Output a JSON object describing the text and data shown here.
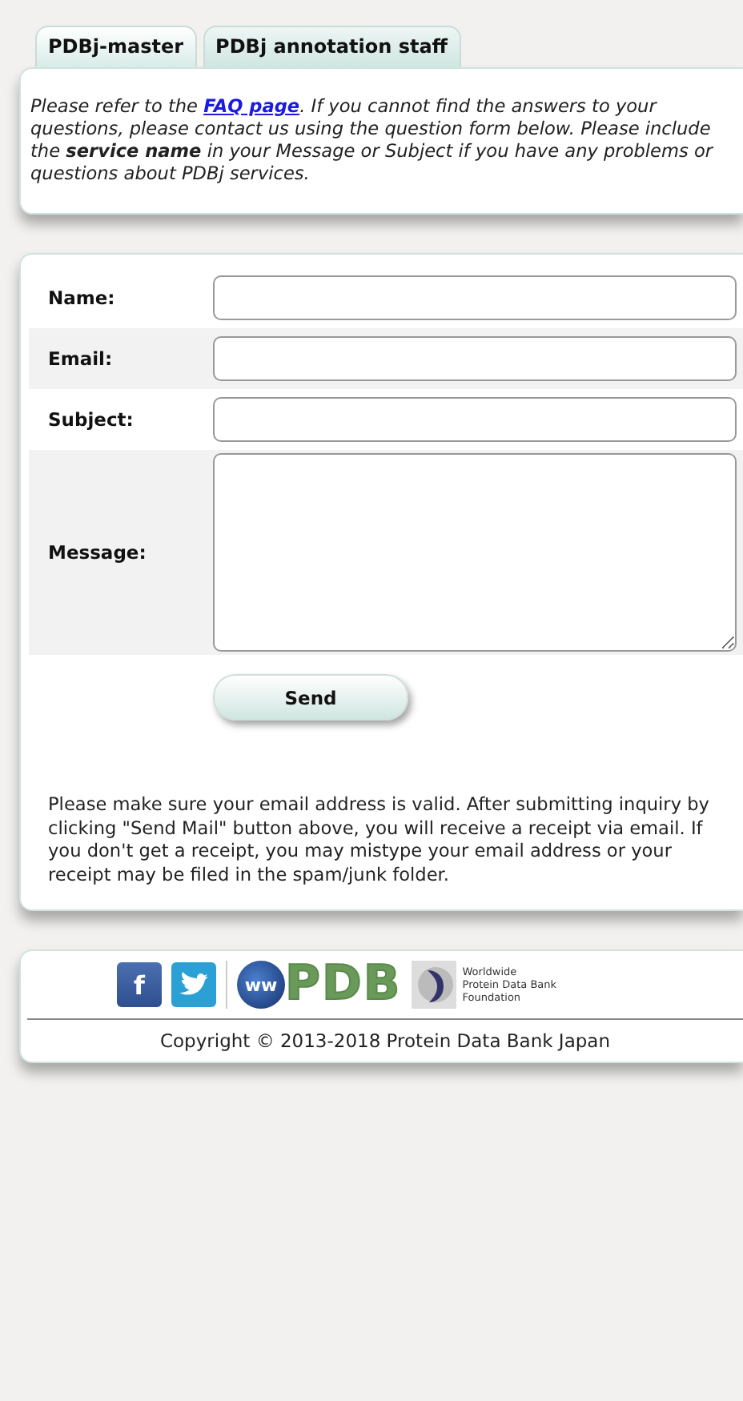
{
  "tabs": [
    {
      "label": "PDBj-master",
      "selected": true
    },
    {
      "label": "PDBj annotation staff",
      "selected": false
    }
  ],
  "intro_parts": {
    "before": "Please refer to the ",
    "link": "FAQ page",
    "after": ". If you cannot find the answers to your questions, please contact us using the question form below. Please include the **service name** in your Message or Subject if you have any problems or questions about PDBj services."
  },
  "form": {
    "fields": [
      {
        "label": "Name:",
        "kind": "text"
      },
      {
        "label": "Email:",
        "kind": "text"
      },
      {
        "label": "Subject:",
        "kind": "text"
      },
      {
        "label": "Message:",
        "kind": "textarea"
      }
    ],
    "submit": "Send",
    "note": "Please make sure your email address is valid. After submitting inquiry by clicking \"Send Mail\" button above, you will receive a receipt via email. If you don't get a receipt, you may mistype your email address or your receipt may be filed in the spam/junk folder."
  },
  "footer": {
    "facebook": "f",
    "wwpdb": {
      "prefix": "ww",
      "name": "PDB"
    },
    "foundation": [
      "Worldwide",
      "Protein Data Bank",
      "Foundation"
    ],
    "copyright": "Copyright © 2013-2018 Protein Data Bank Japan"
  }
}
